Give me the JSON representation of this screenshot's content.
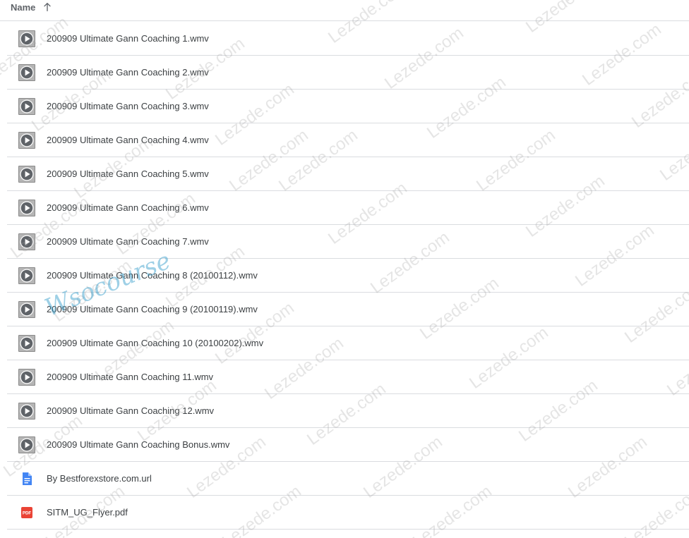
{
  "header": {
    "name_label": "Name",
    "sort_icon": "arrow-up-icon"
  },
  "files": [
    {
      "name": "200909 Ultimate Gann Coaching 1.wmv",
      "type": "video",
      "icon": "video-play-icon"
    },
    {
      "name": "200909 Ultimate Gann Coaching 2.wmv",
      "type": "video",
      "icon": "video-play-icon"
    },
    {
      "name": "200909 Ultimate Gann Coaching 3.wmv",
      "type": "video",
      "icon": "video-play-icon"
    },
    {
      "name": "200909 Ultimate Gann Coaching 4.wmv",
      "type": "video",
      "icon": "video-play-icon"
    },
    {
      "name": "200909 Ultimate Gann Coaching 5.wmv",
      "type": "video",
      "icon": "video-play-icon"
    },
    {
      "name": "200909 Ultimate Gann Coaching 6.wmv",
      "type": "video",
      "icon": "video-play-icon"
    },
    {
      "name": "200909 Ultimate Gann Coaching 7.wmv",
      "type": "video",
      "icon": "video-play-icon"
    },
    {
      "name": "200909 Ultimate Gann Coaching 8 (20100112).wmv",
      "type": "video",
      "icon": "video-play-icon"
    },
    {
      "name": "200909 Ultimate Gann Coaching 9 (20100119).wmv",
      "type": "video",
      "icon": "video-play-icon"
    },
    {
      "name": "200909 Ultimate Gann Coaching 10 (20100202).wmv",
      "type": "video",
      "icon": "video-play-icon"
    },
    {
      "name": "200909 Ultimate Gann Coaching 11.wmv",
      "type": "video",
      "icon": "video-play-icon"
    },
    {
      "name": "200909 Ultimate Gann Coaching 12.wmv",
      "type": "video",
      "icon": "video-play-icon"
    },
    {
      "name": "200909 Ultimate Gann Coaching Bonus.wmv",
      "type": "video",
      "icon": "video-play-icon"
    },
    {
      "name": "By Bestforexstore.com.url",
      "type": "doc",
      "icon": "document-icon"
    },
    {
      "name": "SITM_UG_Flyer.pdf",
      "type": "pdf",
      "icon": "pdf-icon"
    }
  ],
  "watermark": {
    "text": "Lezede.com",
    "logo_text": "Wsocourse"
  },
  "colors": {
    "divider": "#dadce0",
    "text": "#3c4043",
    "header_text": "#5f6368",
    "doc_blue": "#4285f4",
    "pdf_red": "#ea4335",
    "video_gray": "#5f6368"
  }
}
